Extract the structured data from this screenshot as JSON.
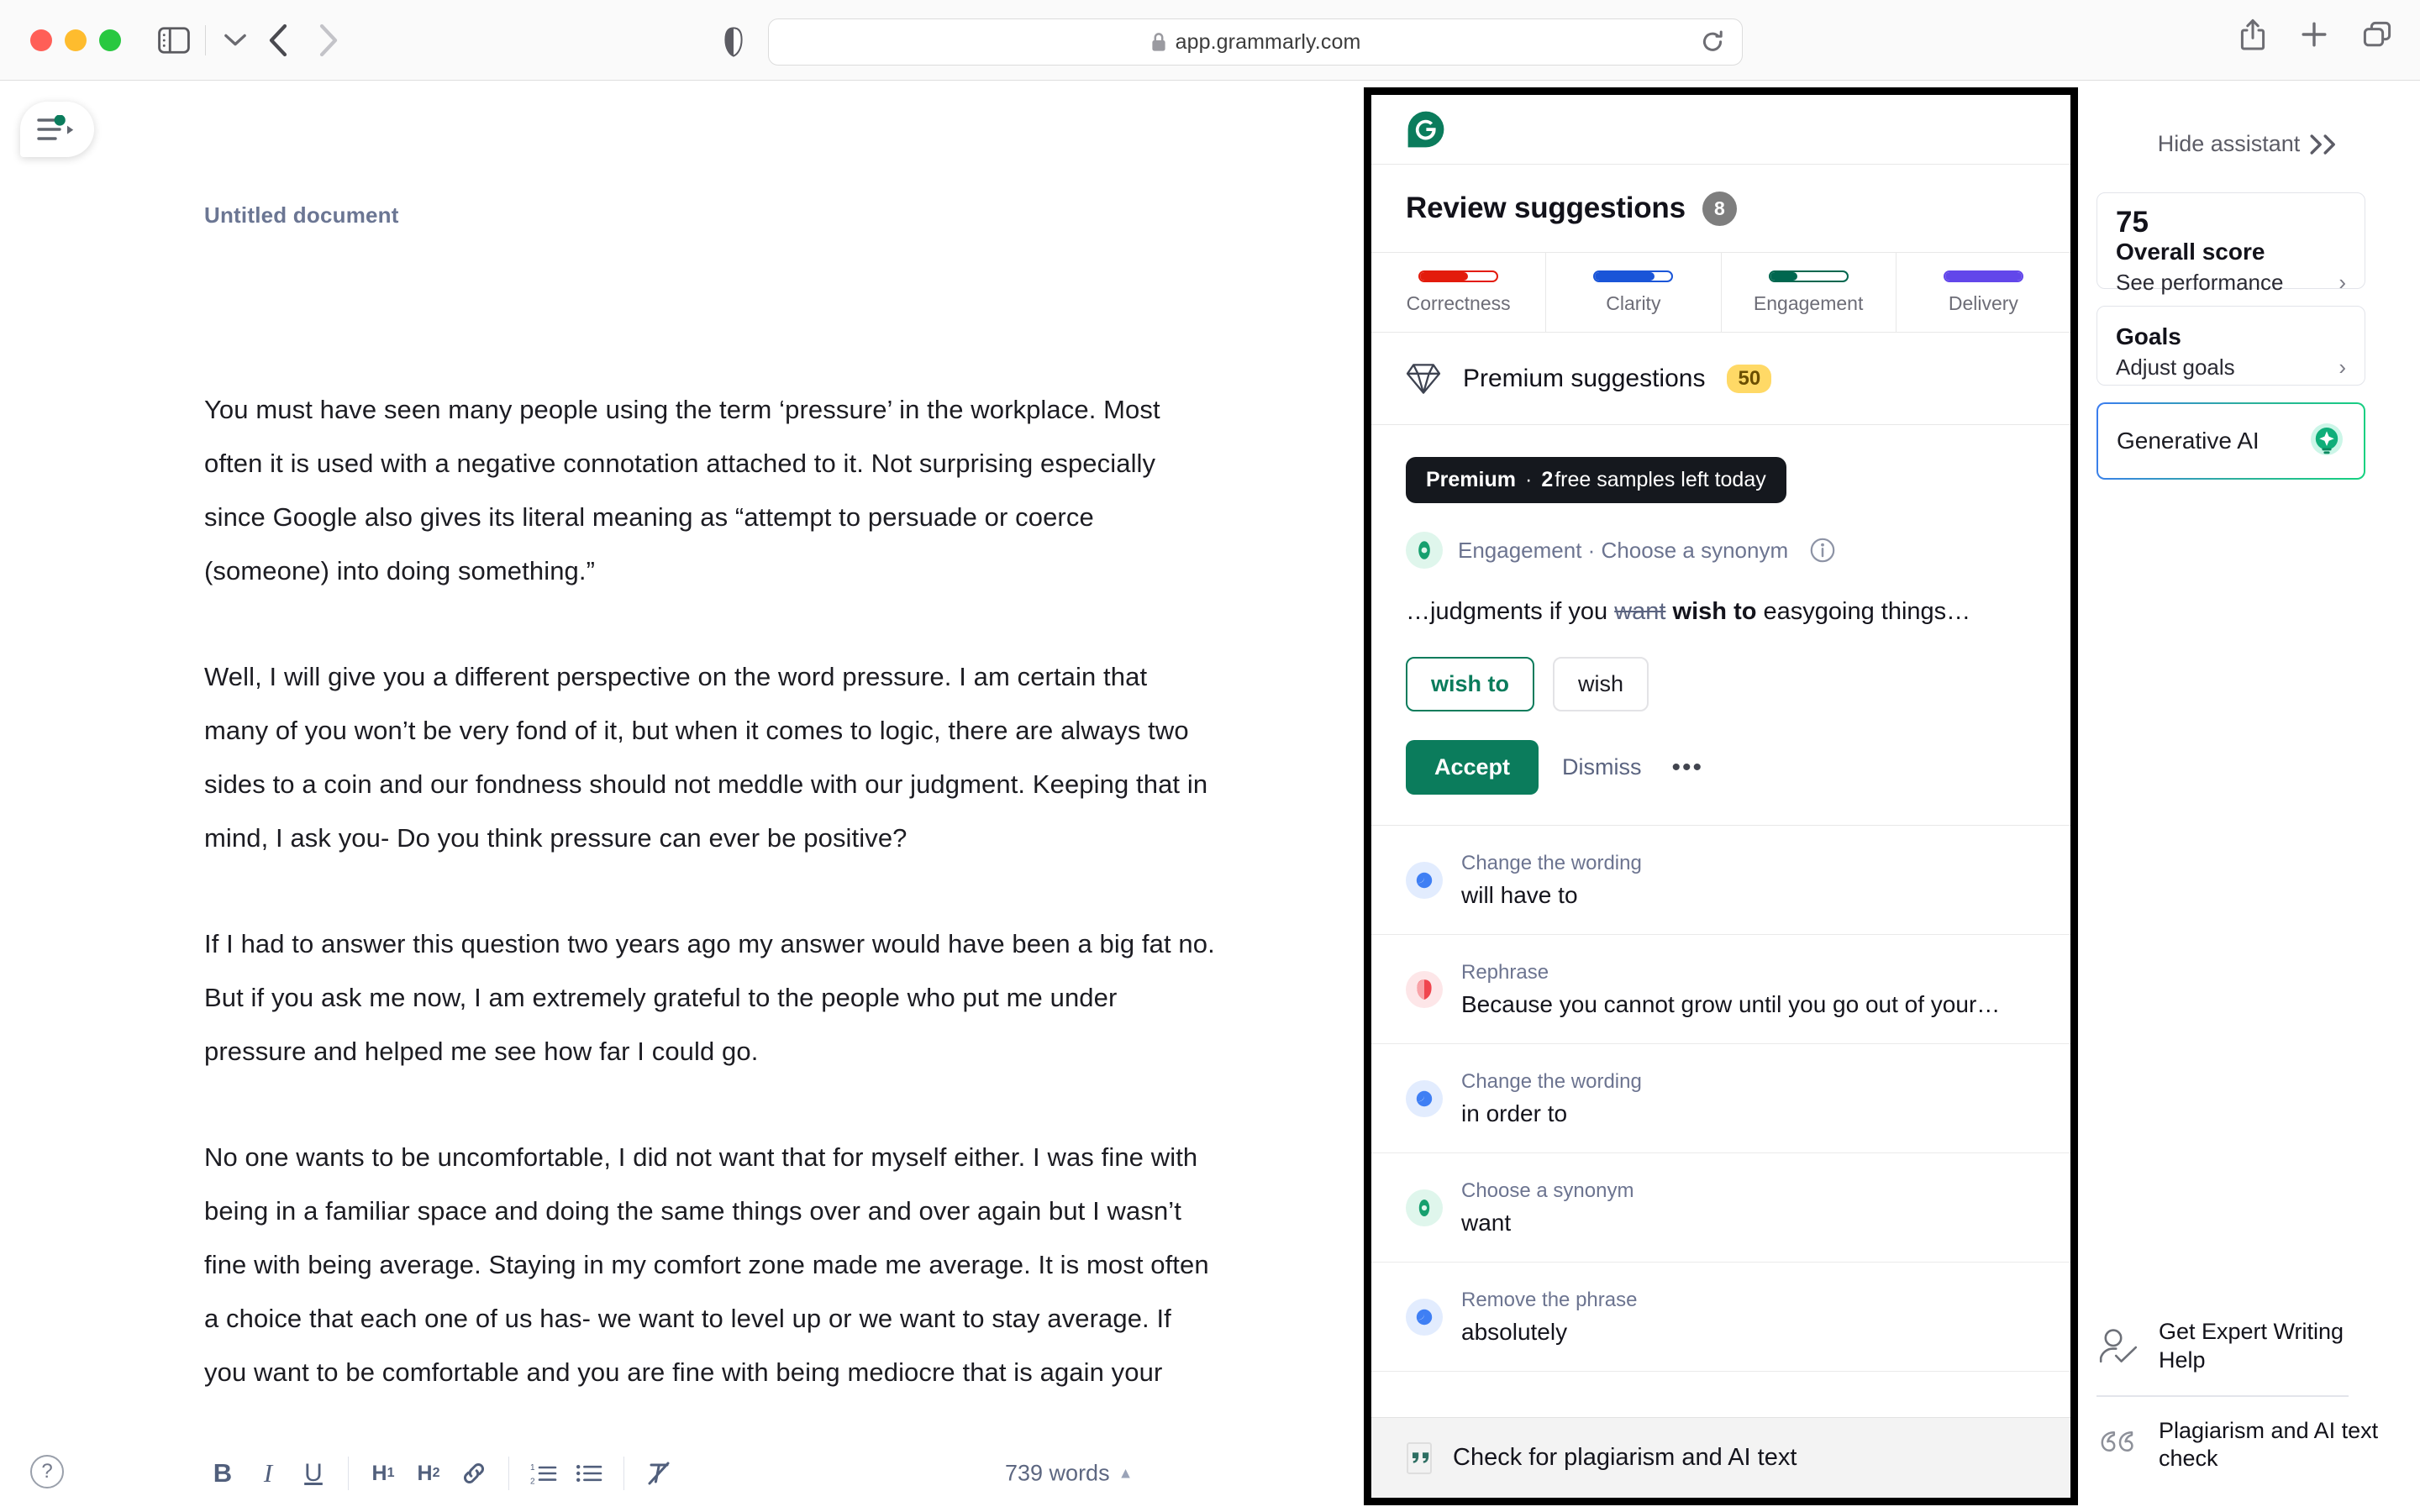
{
  "browser": {
    "url": "app.grammarly.com",
    "lock_icon": "lock-icon",
    "shield_icon": "shield-icon",
    "reload_icon": "reload-icon",
    "back_icon": "chevron-left-icon",
    "forward_icon": "chevron-right-icon",
    "sidebar_icon": "sidebar-toggle-icon",
    "chevron_down_icon": "chevron-down-icon",
    "share_icon": "share-icon",
    "new_tab_icon": "plus-icon",
    "tabs_icon": "tab-overview-icon"
  },
  "editor": {
    "doc_title": "Untitled document",
    "paragraphs": [
      "You must have seen many people using the term ‘pressure’ in the workplace. Most often it is used with a negative connotation attached to it. Not surprising especially since Google also gives its literal meaning as “attempt to persuade or coerce (someone) into doing something.”",
      "Well, I will give you a different perspective on the word pressure. I am certain that many of you won’t be very fond of it, but when it comes to logic, there are always two sides to a coin and our fondness should not meddle with our judgment. Keeping that in mind, I ask you- Do you think pressure can ever be positive?",
      "If I had to answer this question two years ago my answer would have been a big fat no. But if you ask me now, I am extremely grateful to the people who put me under pressure and helped me see how far I could go.",
      "No one wants to be uncomfortable, I did not want that for myself either. I was fine with being in a familiar space and doing the same things over and over again but I wasn’t fine with being average. Staying in my comfort zone made me average. It is most often a choice that each one of us has- we want to level up or we want to stay average. If you want to be comfortable and you are fine with being mediocre that is again your"
    ],
    "toolbar": {
      "bold": "B",
      "italic": "I",
      "underline": "U",
      "h1": "H",
      "h1_sub": "1",
      "h2": "H",
      "h2_sub": "2",
      "link_icon": "link-icon",
      "ordered_list_icon": "ordered-list-icon",
      "bullet_list_icon": "bullet-list-icon",
      "clear_format_icon": "clear-formatting-icon",
      "word_count": "739 words",
      "word_count_caret": "▲"
    },
    "help_label": "?"
  },
  "assistant": {
    "logo_icon": "grammarly-logo-icon",
    "header_title": "Review suggestions",
    "header_count": "8",
    "score_tabs": [
      {
        "label": "Correctness",
        "color": "#e31b0c",
        "fill_pct": 62
      },
      {
        "label": "Clarity",
        "color": "#1a55d8",
        "fill_pct": 78
      },
      {
        "label": "Engagement",
        "color": "#00674f",
        "fill_pct": 36
      },
      {
        "label": "Delivery",
        "color": "#6247ea",
        "fill_pct": 100
      }
    ],
    "premium_row": {
      "icon": "diamond-icon",
      "label": "Premium suggestions",
      "count": "50"
    },
    "card": {
      "chip_bold": "Premium",
      "chip_dot": "·",
      "chip_rest_bold": "2",
      "chip_rest": " free samples left today",
      "category": "Engagement · Choose a synonym",
      "info_icon": "info-icon",
      "sentence_prefix": "…judgments if you ",
      "sentence_strike": "want",
      "sentence_bold": " wish to",
      "sentence_suffix": " easygoing things…",
      "alternatives": [
        {
          "label": "wish to",
          "selected": true
        },
        {
          "label": "wish",
          "selected": false
        }
      ],
      "accept_label": "Accept",
      "dismiss_label": "Dismiss",
      "more_label": "•••"
    },
    "suggestions": [
      {
        "kind": "Change the wording",
        "value": "will have to",
        "color": "#3f7ff4",
        "bg": "#e2ecfe",
        "shape": "wording"
      },
      {
        "kind": "Rephrase",
        "value": "Because you cannot grow until you go out of your…",
        "color": "#f0454e",
        "bg": "#fde6e8",
        "shape": "shield"
      },
      {
        "kind": "Change the wording",
        "value": "in order to",
        "color": "#3f7ff4",
        "bg": "#e2ecfe",
        "shape": "wording"
      },
      {
        "kind": "Choose a synonym",
        "value": "want",
        "color": "#16a06e",
        "bg": "#dff6ec",
        "shape": "synonym"
      },
      {
        "kind": "Remove the phrase",
        "value": "absolutely",
        "color": "#3f7ff4",
        "bg": "#e2ecfe",
        "shape": "wording"
      }
    ],
    "plagiarism": {
      "icon": "quote-icon",
      "label": "Check for plagiarism and AI text"
    }
  },
  "sidebar": {
    "hide_label": "Hide assistant",
    "hide_chevrons": "≫",
    "score_card": {
      "score": "75",
      "title": "Overall score",
      "sub": "See performance",
      "chevron": "›"
    },
    "goals_card": {
      "title": "Goals",
      "sub": "Adjust goals",
      "chevron": "›"
    },
    "genai": {
      "label": "Generative AI",
      "icon": "lightbulb-sparkle-icon",
      "border_start": "#3b7cf0",
      "border_end": "#15d27f"
    },
    "bottom_items": [
      {
        "label": "Get Expert Writing Help",
        "icon": "person-check-icon"
      },
      {
        "label": "Plagiarism and AI text check",
        "icon": "quote-outline-icon"
      }
    ]
  }
}
